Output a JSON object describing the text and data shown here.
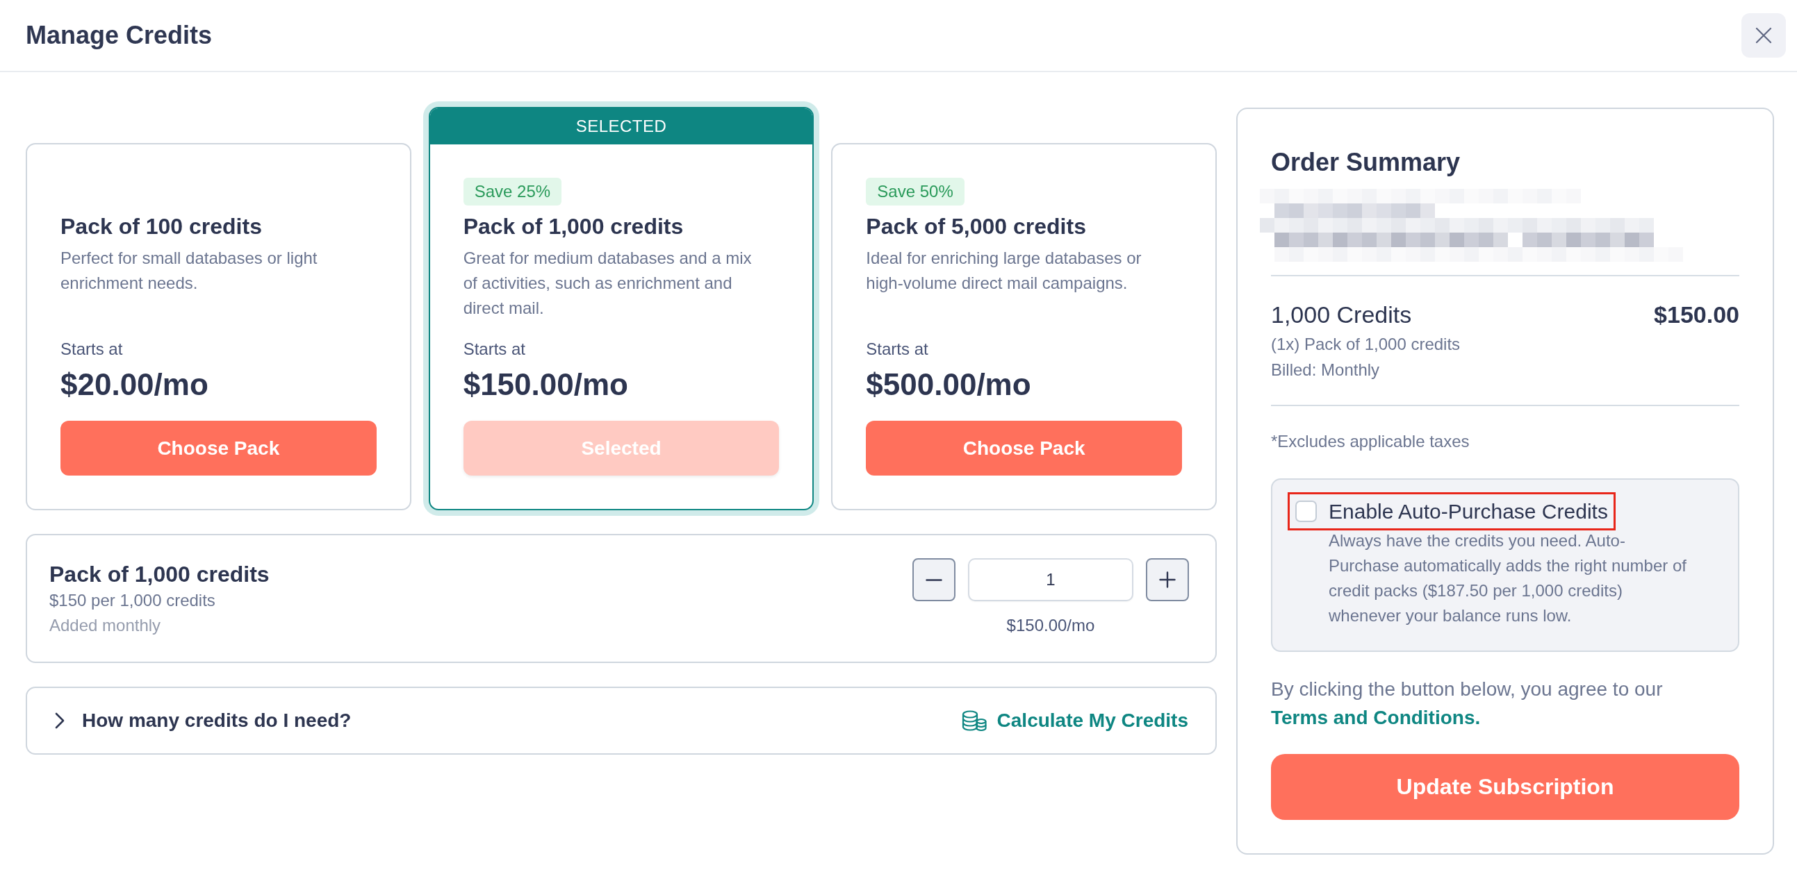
{
  "header": {
    "title": "Manage Credits"
  },
  "packs": [
    {
      "title": "Pack of 100 credits",
      "description": "Perfect for small databases or light enrichment needs.",
      "price_caption": "Starts at",
      "price": "$20.00/mo",
      "button": "Choose Pack",
      "selected": false
    },
    {
      "banner": "SELECTED",
      "badge": "Save 25%",
      "title": "Pack of 1,000 credits",
      "description": "Great for medium databases and a mix of activities, such as enrichment and direct mail.",
      "price_caption": "Starts at",
      "price": "$150.00/mo",
      "button": "Selected",
      "selected": true
    },
    {
      "badge": "Save 50%",
      "title": "Pack of 5,000 credits",
      "description": "Ideal for enriching large databases or high-volume direct mail campaigns.",
      "price_caption": "Starts at",
      "price": "$500.00/mo",
      "button": "Choose Pack",
      "selected": false
    }
  ],
  "quantity": {
    "title": "Pack of 1,000 credits",
    "rate": "$150 per 1,000 credits",
    "frequency": "Added monthly",
    "value": "1",
    "subtotal": "$150.00/mo"
  },
  "help": {
    "question": "How many credits do I need?",
    "expanded": false,
    "action": "Calculate My Credits"
  },
  "summary": {
    "title": "Order Summary",
    "line_item": {
      "name": "1,000 Credits",
      "price": "$150.00",
      "details": [
        "(1x) Pack of 1,000 credits",
        "Billed: Monthly"
      ]
    },
    "tax_note": "*Excludes applicable taxes",
    "auto_purchase": {
      "label": "Enable Auto-Purchase Credits",
      "checked": false,
      "highlighted": true,
      "description": "Always have the credits you need. Auto-Purchase automatically adds the right number of credit packs ($187.50 per 1,000 credits) whenever your balance runs low."
    },
    "agreement": {
      "text": "By clicking the button below, you agree to our",
      "link": "Terms and Conditions."
    },
    "submit": "Update Subscription"
  }
}
